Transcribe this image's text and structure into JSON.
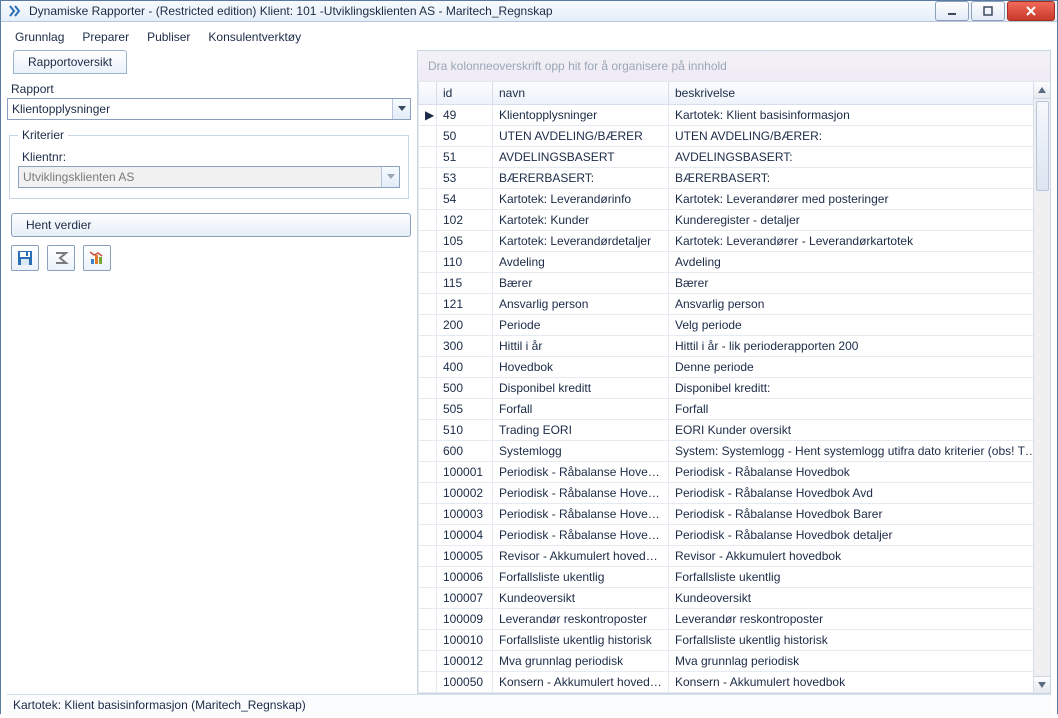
{
  "window": {
    "title": "Dynamiske Rapporter - (Restricted edition)  Klient: 101 -Utviklingsklienten AS - Maritech_Regnskap"
  },
  "menu": {
    "grunnlag": "Grunnlag",
    "preparer": "Preparer",
    "publiser": "Publiser",
    "konsulent": "Konsulentverktøy"
  },
  "left": {
    "tab_rapportoversikt": "Rapportoversikt",
    "label_rapport": "Rapport",
    "rapport_value": "Klientopplysninger",
    "kriterier_legend": "Kriterier",
    "label_klientnr": "Klientnr:",
    "klient_value": "Utviklingsklienten AS",
    "hent_verdier": "Hent verdier"
  },
  "grid": {
    "group_hint": "Dra kolonneoverskrift opp hit for å organisere på innhold",
    "col_id": "id",
    "col_navn": "navn",
    "col_beskrivelse": "beskrivelse",
    "rows": [
      {
        "mark": "▶",
        "id": "49",
        "navn": "Klientopplysninger",
        "besk": "Kartotek: Klient basisinformasjon"
      },
      {
        "mark": "",
        "id": "50",
        "navn": "UTEN AVDELING/BÆRER",
        "besk": "UTEN AVDELING/BÆRER:"
      },
      {
        "mark": "",
        "id": "51",
        "navn": "AVDELINGSBASERT",
        "besk": "AVDELINGSBASERT:"
      },
      {
        "mark": "",
        "id": "53",
        "navn": "BÆRERBASERT:",
        "besk": "BÆRERBASERT:"
      },
      {
        "mark": "",
        "id": "54",
        "navn": "Kartotek: Leverandørinfo",
        "besk": "Kartotek: Leverandører med posteringer"
      },
      {
        "mark": "",
        "id": "102",
        "navn": "Kartotek: Kunder",
        "besk": "Kunderegister - detaljer"
      },
      {
        "mark": "",
        "id": "105",
        "navn": "Kartotek: Leverandørdetaljer",
        "besk": "Kartotek: Leverandører - Leverandørkartotek"
      },
      {
        "mark": "",
        "id": "110",
        "navn": "Avdeling",
        "besk": "Avdeling"
      },
      {
        "mark": "",
        "id": "115",
        "navn": "Bærer",
        "besk": "Bærer"
      },
      {
        "mark": "",
        "id": "121",
        "navn": "Ansvarlig person",
        "besk": "Ansvarlig person"
      },
      {
        "mark": "",
        "id": "200",
        "navn": "Periode",
        "besk": "Velg periode"
      },
      {
        "mark": "",
        "id": "300",
        "navn": "Hittil i år",
        "besk": "Hittil i år - lik perioderapporten 200"
      },
      {
        "mark": "",
        "id": "400",
        "navn": "Hovedbok",
        "besk": "Denne periode"
      },
      {
        "mark": "",
        "id": "500",
        "navn": "Disponibel kreditt",
        "besk": "Disponibel kreditt:"
      },
      {
        "mark": "",
        "id": "505",
        "navn": "Forfall",
        "besk": "Forfall"
      },
      {
        "mark": "",
        "id": "510",
        "navn": "Trading EORI",
        "besk": "EORI Kunder oversikt"
      },
      {
        "mark": "",
        "id": "600",
        "navn": "Systemlogg",
        "besk": "System: Systemlogg - Hent systemlogg utifra dato kriterier (obs! TOM d..."
      },
      {
        "mark": "",
        "id": "100001",
        "navn": "Periodisk - Råbalanse Hovedbok",
        "besk": "Periodisk - Råbalanse Hovedbok"
      },
      {
        "mark": "",
        "id": "100002",
        "navn": "Periodisk - Råbalanse Hovedbok ...",
        "besk": "Periodisk - Råbalanse Hovedbok Avd"
      },
      {
        "mark": "",
        "id": "100003",
        "navn": "Periodisk - Råbalanse Hovedbok B...",
        "besk": "Periodisk - Råbalanse Hovedbok Barer"
      },
      {
        "mark": "",
        "id": "100004",
        "navn": "Periodisk - Råbalanse Hovedbok d...",
        "besk": "Periodisk - Råbalanse Hovedbok detaljer"
      },
      {
        "mark": "",
        "id": "100005",
        "navn": "Revisor - Akkumulert hovedbok",
        "besk": "Revisor - Akkumulert hovedbok"
      },
      {
        "mark": "",
        "id": "100006",
        "navn": "Forfallsliste ukentlig",
        "besk": "Forfallsliste ukentlig"
      },
      {
        "mark": "",
        "id": "100007",
        "navn": "Kundeoversikt",
        "besk": "Kundeoversikt"
      },
      {
        "mark": "",
        "id": "100009",
        "navn": "Leverandør reskontroposter",
        "besk": "Leverandør reskontroposter"
      },
      {
        "mark": "",
        "id": "100010",
        "navn": "Forfallsliste ukentlig historisk",
        "besk": "Forfallsliste ukentlig historisk"
      },
      {
        "mark": "",
        "id": "100012",
        "navn": "Mva grunnlag periodisk",
        "besk": "Mva grunnlag periodisk"
      },
      {
        "mark": "",
        "id": "100050",
        "navn": "Konsern - Akkumulert hovedbok",
        "besk": "Konsern - Akkumulert hovedbok"
      }
    ]
  },
  "statusbar": {
    "text": "Kartotek: Klient basisinformasjon (Maritech_Regnskap)"
  }
}
